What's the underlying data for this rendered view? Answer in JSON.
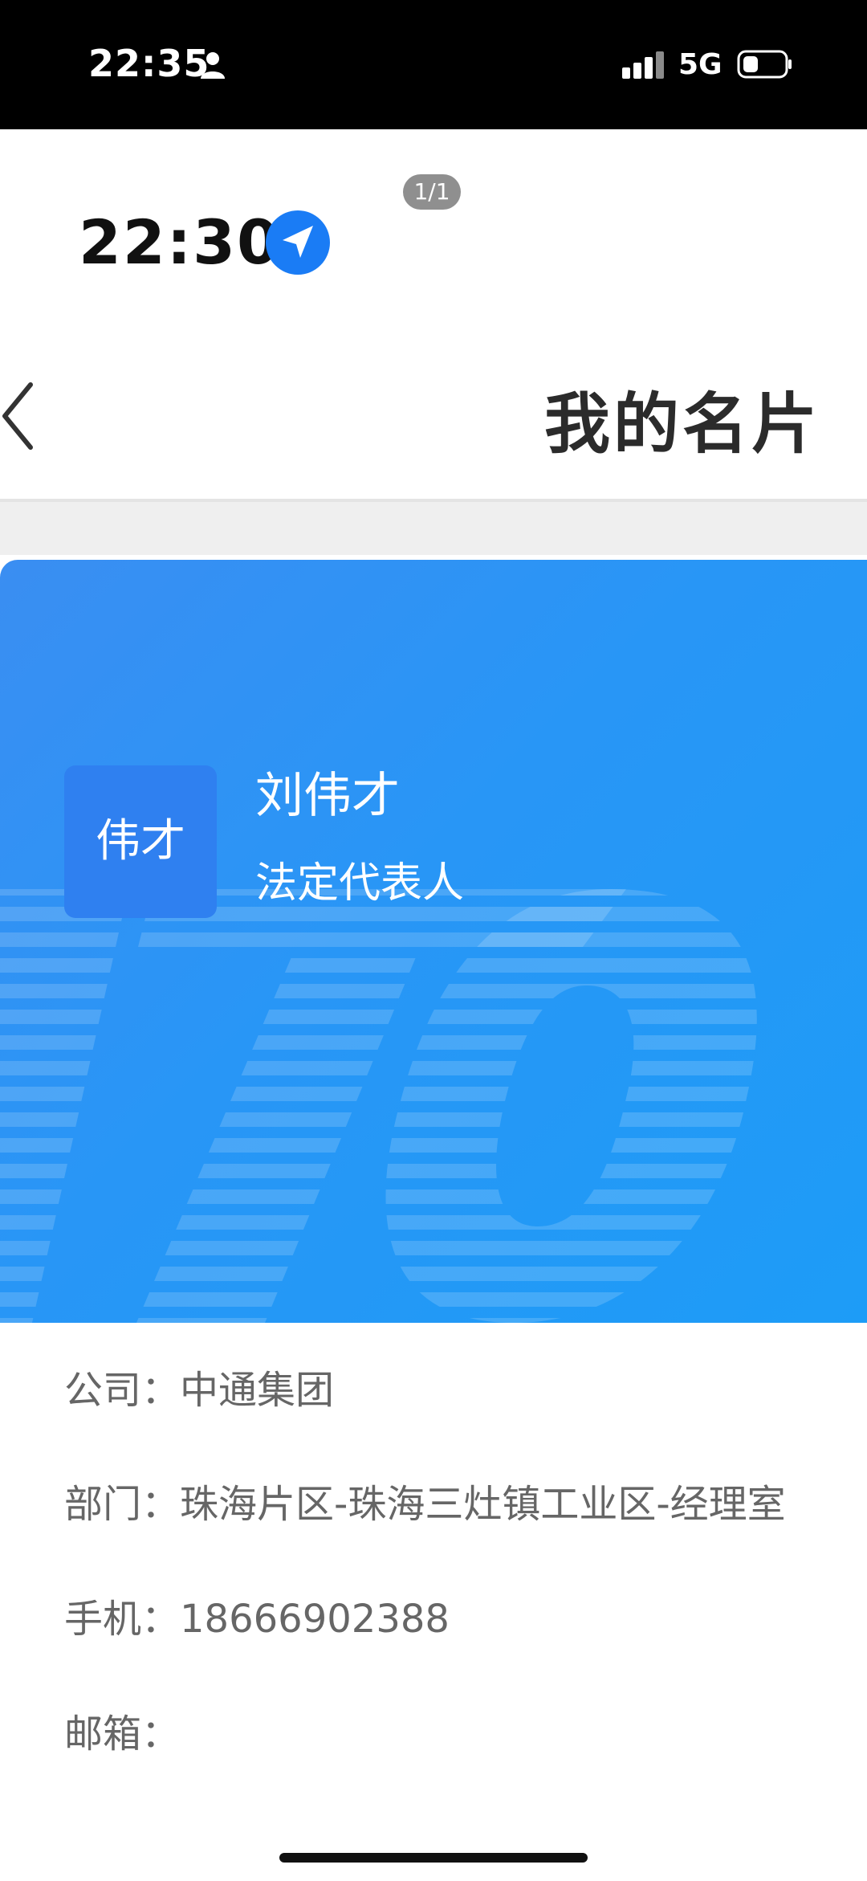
{
  "status_bar": {
    "time": "22:35",
    "network": "5G",
    "icons": [
      "person-icon",
      "signal-icon",
      "battery-icon"
    ]
  },
  "screenshot_view": {
    "page_indicator": "1/1"
  },
  "inner_status": {
    "time": "22:30",
    "icon": "location-arrow-icon",
    "icon_color": "#1a7cf5"
  },
  "nav": {
    "title": "我的名片",
    "back_icon": "back-chevron-icon"
  },
  "card": {
    "avatar_text": "伟才",
    "name": "刘伟才",
    "title": "法定代表人",
    "watermark": "ZTO",
    "gradient_start": "#3a8ef2",
    "gradient_end": "#1d9cf7"
  },
  "info": {
    "company_label": "公司：",
    "company_value": "中通集团",
    "department_label": "部门：",
    "department_value": "珠海片区-珠海三灶镇工业区-经理室",
    "phone_label": "手机：",
    "phone_value": "18666902388",
    "email_label": "邮箱：",
    "email_value": ""
  }
}
